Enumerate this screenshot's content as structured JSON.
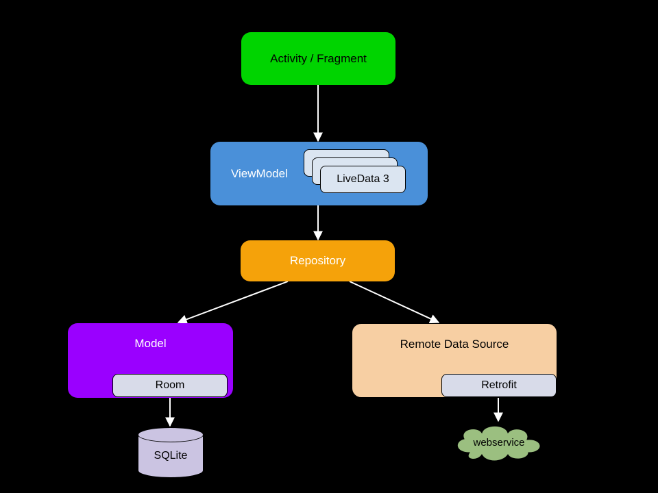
{
  "nodes": {
    "activity": {
      "label": "Activity / Fragment"
    },
    "viewmodel": {
      "label": "ViewModel"
    },
    "livedata": {
      "label": "LiveData 3"
    },
    "repository": {
      "label": "Repository"
    },
    "model": {
      "label": "Model"
    },
    "room": {
      "label": "Room"
    },
    "remote": {
      "label": "Remote Data Source"
    },
    "retrofit": {
      "label": "Retrofit"
    },
    "sqlite": {
      "label": "SQLite"
    },
    "webservice": {
      "label": "webservice"
    }
  },
  "colors": {
    "activity": "#00d400",
    "viewmodel": "#4a90d9",
    "repository": "#f5a20a",
    "model": "#9a00ff",
    "remote": "#f7cfa3",
    "sub": "#d8dbe9",
    "db": "#cbc4e2",
    "cloud": "#9bbf80",
    "arrow": "#ffffff"
  }
}
